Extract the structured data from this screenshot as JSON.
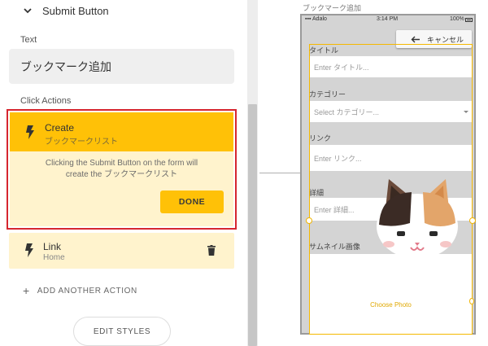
{
  "left_panel": {
    "section_title": "Submit Button",
    "text_label": "Text",
    "text_value": "ブックマーク追加",
    "click_actions_label": "Click Actions",
    "actions": [
      {
        "title": "Create",
        "subtitle": "ブックマークリスト",
        "message_line1": "Clicking the Submit Button on the form will",
        "message_line2": "create the ブックマークリスト",
        "done_label": "DONE"
      },
      {
        "title": "Link",
        "subtitle": "Home"
      }
    ],
    "add_action_label": "ADD ANOTHER ACTION",
    "edit_styles_label": "EDIT STYLES"
  },
  "canvas": {
    "screen_title": "ブックマーク追加",
    "status": {
      "carrier": "Adalo",
      "time": "3:14 PM",
      "battery": "100%"
    },
    "cancel_label": "キャンセル",
    "fields": [
      {
        "label": "タイトル",
        "placeholder": "Enter タイトル..."
      },
      {
        "label": "カテゴリー",
        "placeholder": "Select カテゴリー..."
      },
      {
        "label": "リンク",
        "placeholder": "Enter リンク..."
      },
      {
        "label": "詳細",
        "placeholder": "Enter 詳細..."
      },
      {
        "label": "サムネイル画像"
      }
    ],
    "choose_photo_label": "Choose Photo"
  },
  "colors": {
    "accent": "#ffc107",
    "accent_light": "#fff3cd",
    "highlight_border": "#d6262f",
    "selection": "#f5b800"
  }
}
